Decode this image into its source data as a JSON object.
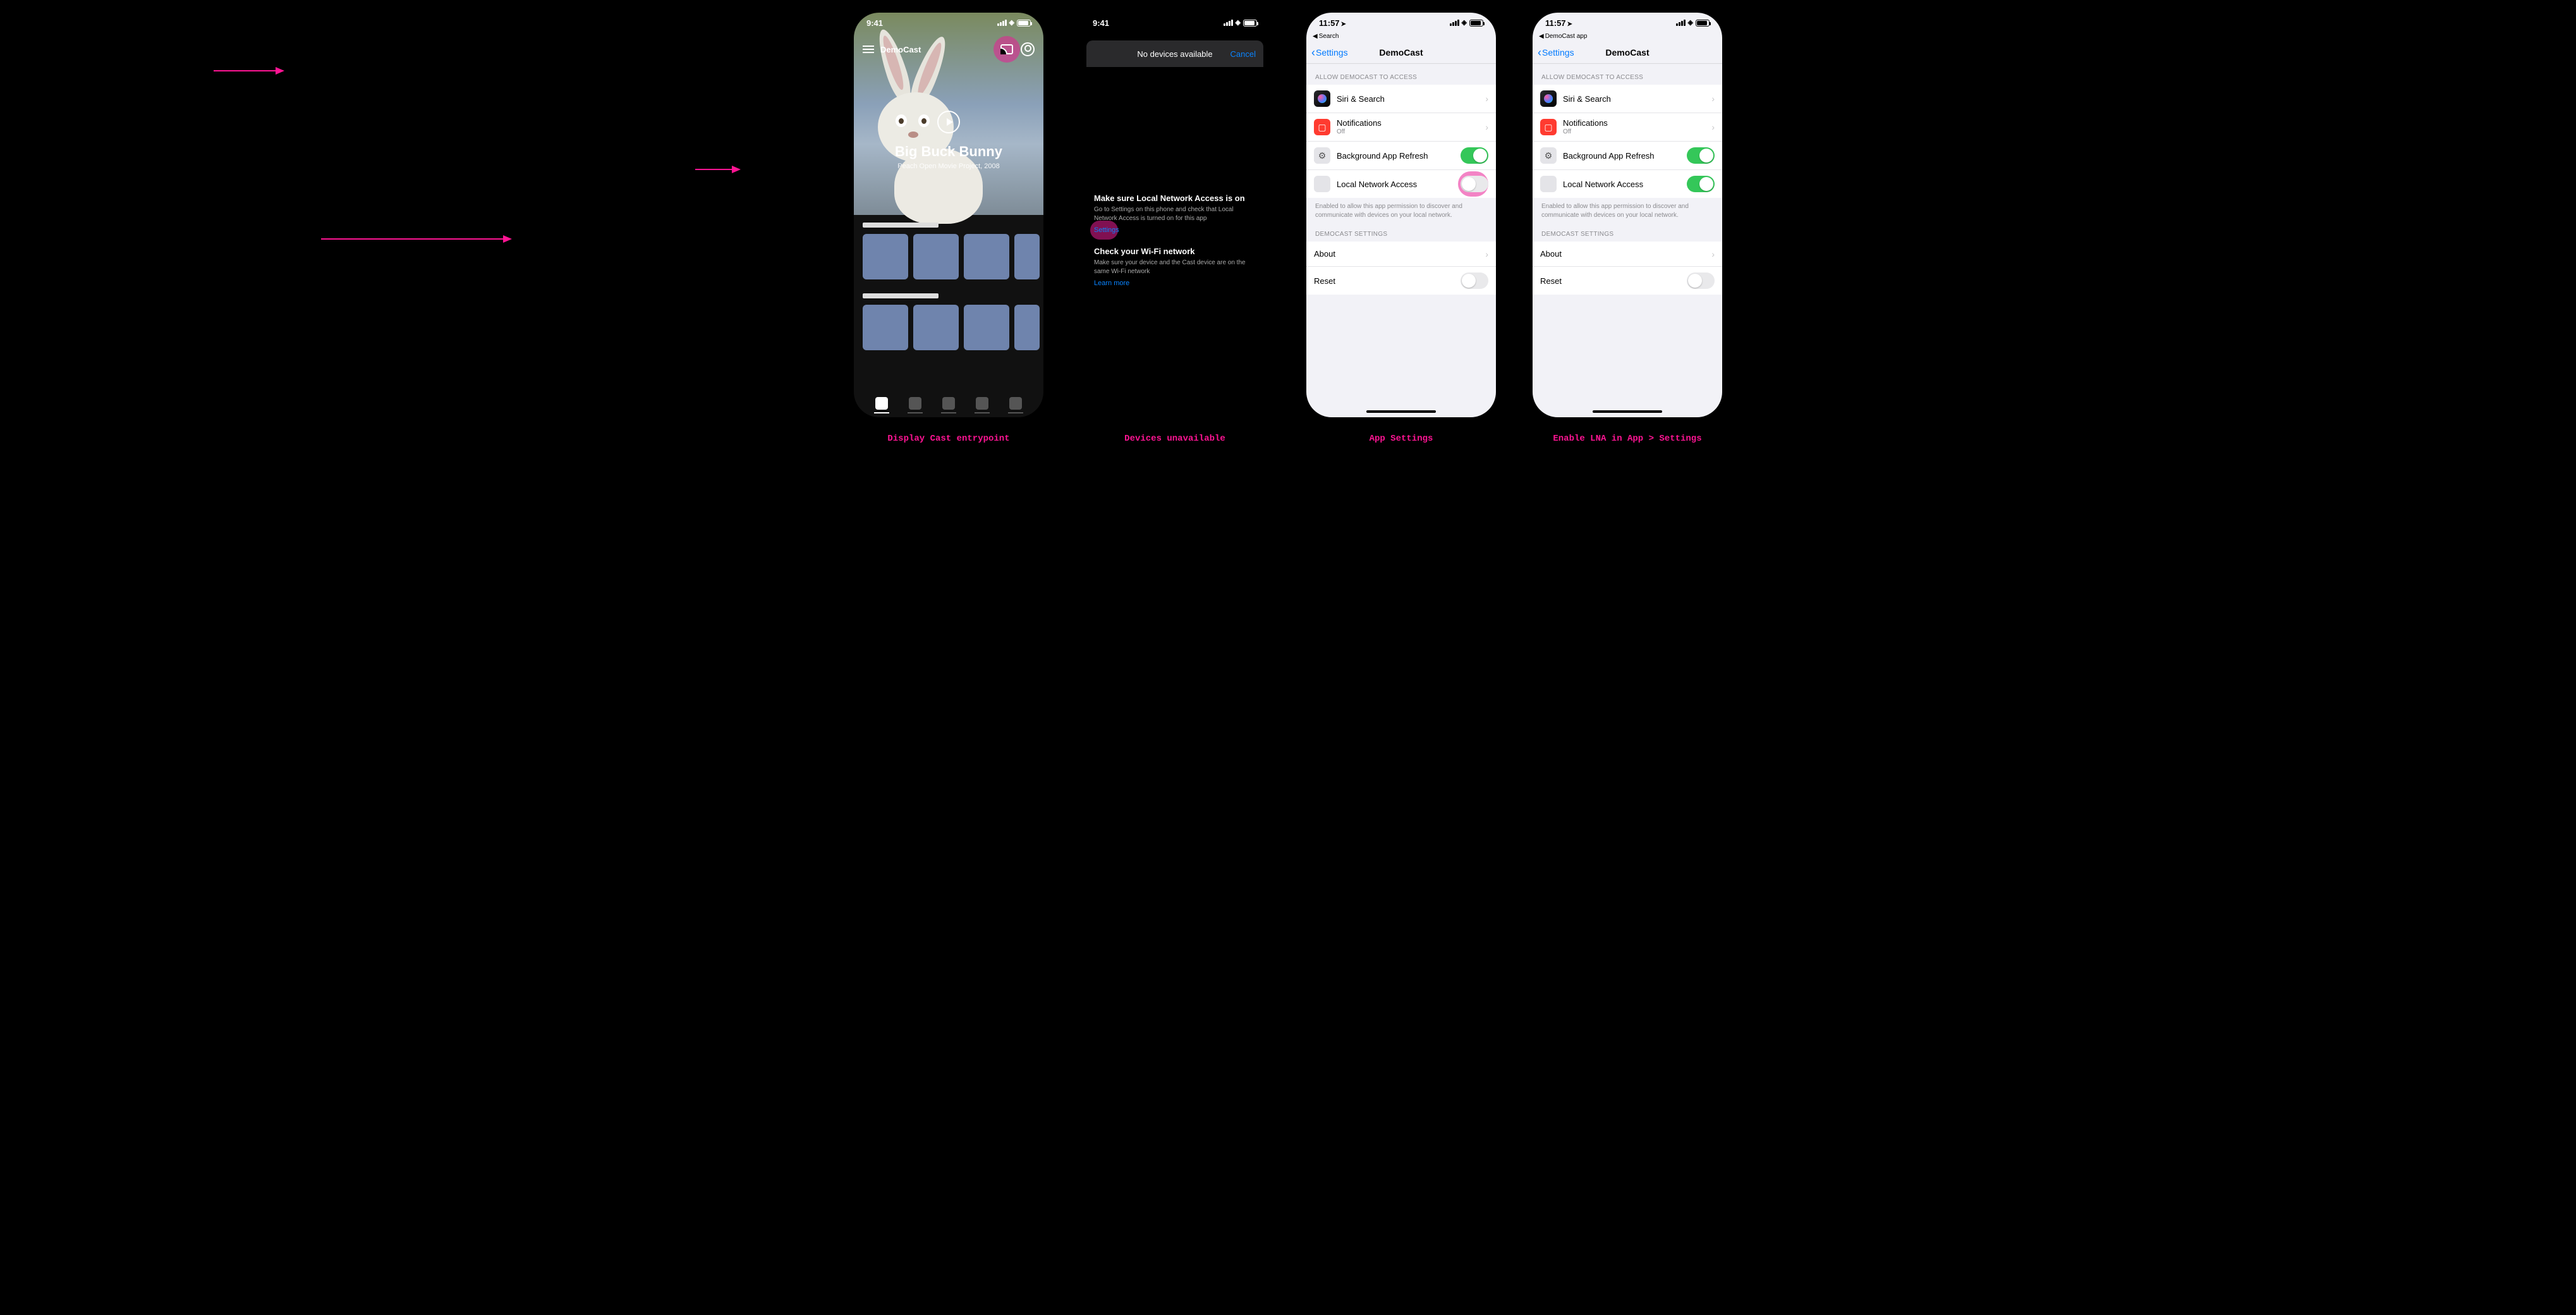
{
  "captions": {
    "p1": "Display Cast entrypoint",
    "p2": "Devices unavailable",
    "p3": "App Settings",
    "p4": "Enable LNA in App > Settings"
  },
  "status": {
    "time_demo": "9:41",
    "time_real": "11:57"
  },
  "phone1": {
    "app_name": "DemoCast",
    "hero_title": "Big Buck Bunny",
    "hero_subtitle": "Peach Open Movie Project, 2008"
  },
  "phone2": {
    "sheet_title": "No devices available",
    "cancel": "Cancel",
    "h1": "Make sure Local Network Access is on",
    "p1": "Go to Settings on this phone and check that Local Network Access is turned on for this app",
    "link1": "Settings",
    "h2": "Check your Wi-Fi network",
    "p2": "Make sure your device and the Cast device are on the same Wi-Fi network",
    "link2": "Learn more"
  },
  "settings_common": {
    "breadcrumb3": "Search",
    "breadcrumb4": "DemoCast app",
    "back": "Settings",
    "title": "DemoCast",
    "section_access": "ALLOW DEMOCAST TO ACCESS",
    "row_siri": "Siri & Search",
    "row_notif": "Notifications",
    "row_notif_sub": "Off",
    "row_bg": "Background App Refresh",
    "row_lna": "Local Network Access",
    "lna_note": "Enabled to allow this app permission to discover and communicate with devices on your local network.",
    "section_app": "DEMOCAST SETTINGS",
    "row_about": "About",
    "row_reset": "Reset"
  }
}
